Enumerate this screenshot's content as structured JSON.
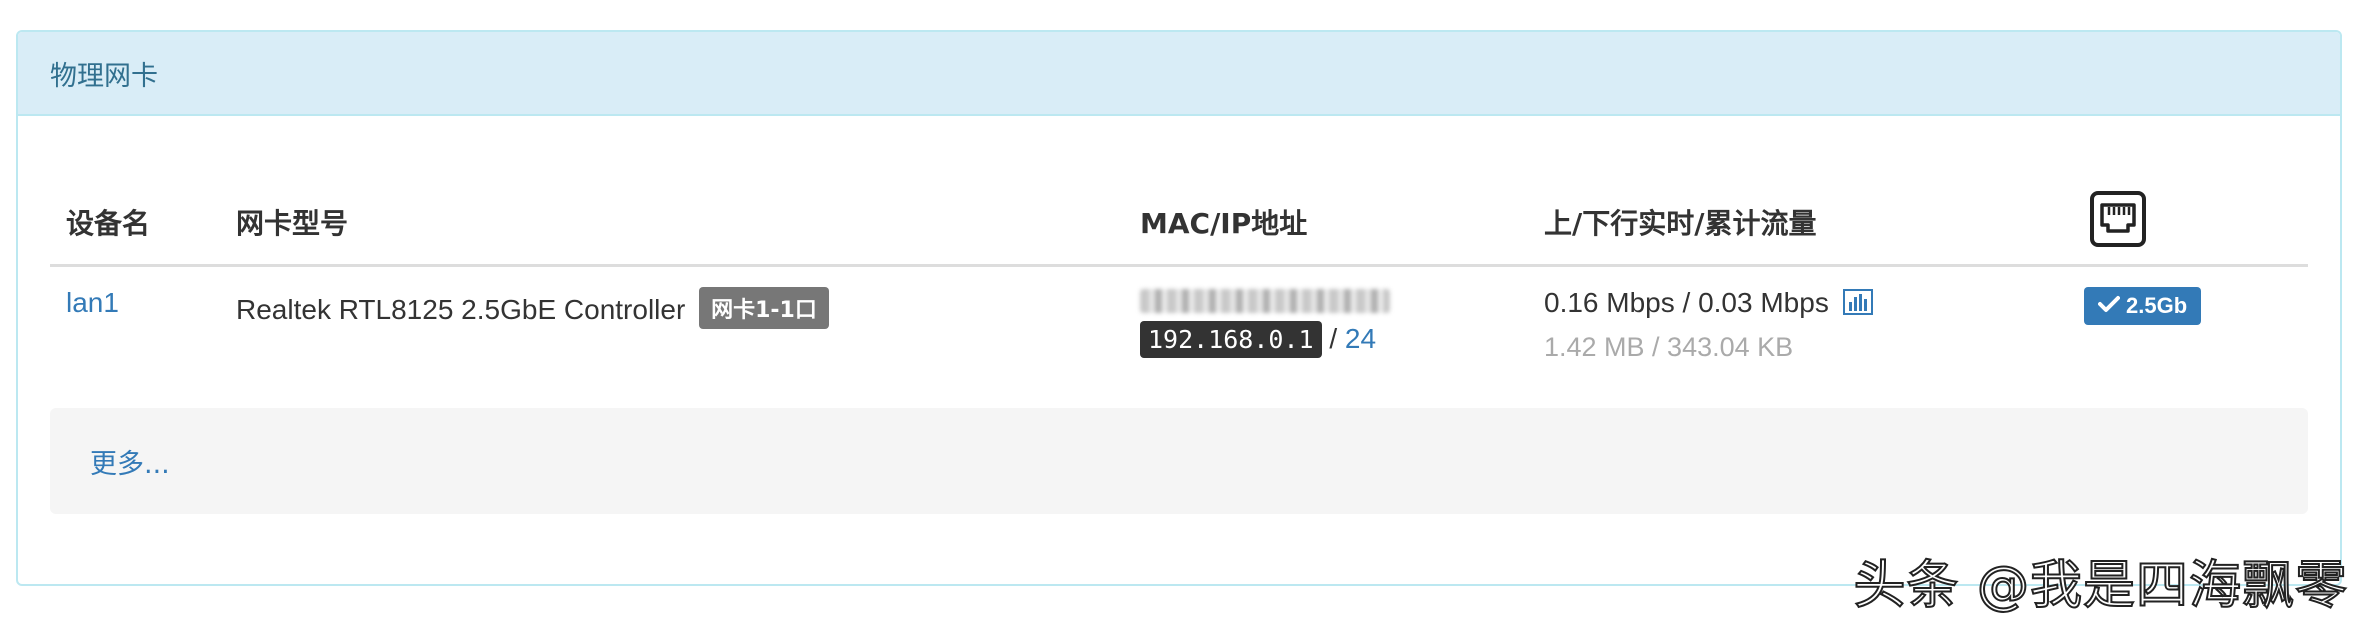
{
  "panel": {
    "title": "物理网卡"
  },
  "table": {
    "headers": {
      "device": "设备名",
      "model": "网卡型号",
      "mac_ip": "MAC/IP地址",
      "traffic": "上/下行实时/累计流量"
    },
    "rows": [
      {
        "device": "lan1",
        "model": "Realtek RTL8125 2.5GbE Controller",
        "port_label": "网卡1-1口",
        "ip": "192.168.0.1",
        "ip_separator": "/",
        "prefix": "24",
        "realtime": "0.16 Mbps / 0.03 Mbps",
        "total": "1.42 MB / 343.04 KB",
        "link_speed": "2.5Gb"
      }
    ]
  },
  "more": {
    "label": "更多..."
  },
  "watermark": "头条 @我是四海飘零",
  "icons": {
    "header_port": "ethernet-port-icon",
    "traffic_chart": "bar-chart-icon",
    "link_check": "check-icon"
  },
  "colors": {
    "heading_bg": "#d9edf7",
    "heading_text": "#31708f",
    "link": "#337ab7",
    "badge_gray": "#777777",
    "badge_blue": "#337ab7"
  }
}
